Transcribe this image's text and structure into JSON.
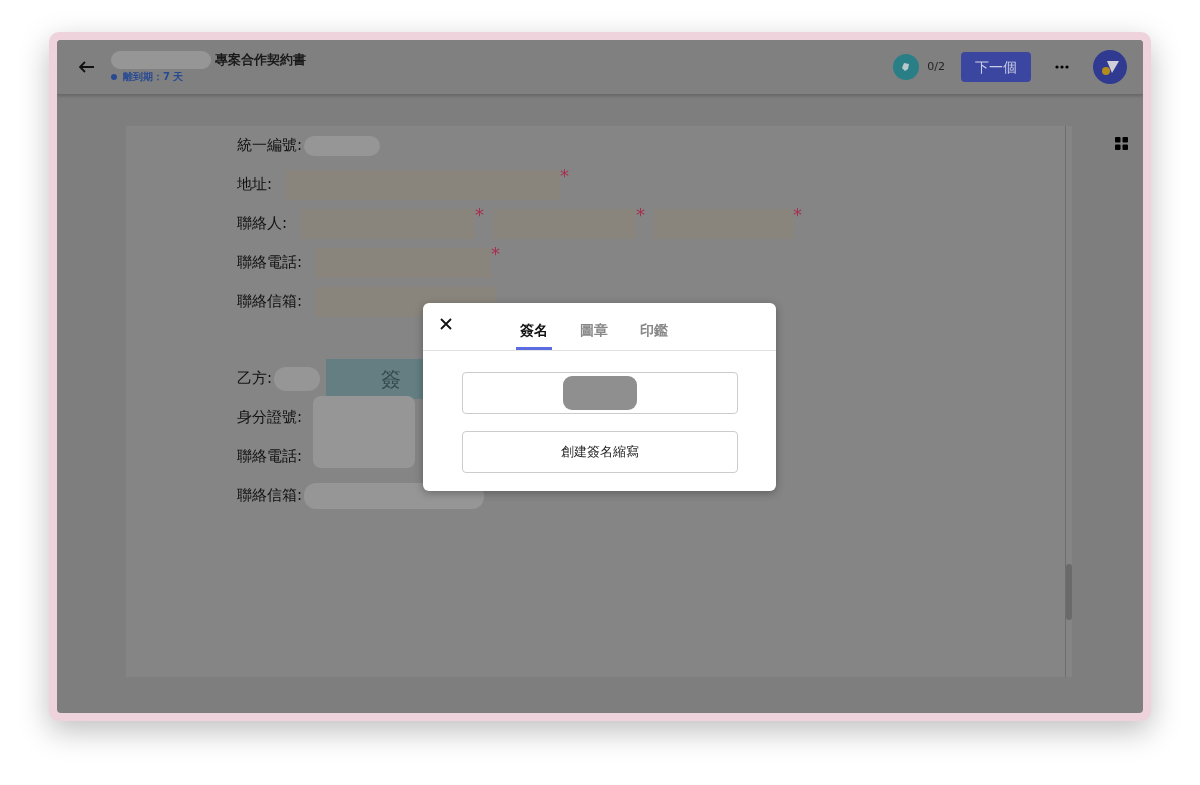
{
  "header": {
    "title": "專案合作契約書",
    "due": "離到期：7 天",
    "progress": "0/2",
    "next_button": "下一個"
  },
  "form": {
    "rows": [
      {
        "label": "統一編號:",
        "kind": "redacted"
      },
      {
        "label": "地址:",
        "kind": "fields",
        "fields": [
          {
            "required_mark": "*"
          }
        ]
      },
      {
        "label": "聯絡人:",
        "kind": "fields",
        "fields": [
          {
            "required_mark": "*"
          },
          {
            "required_mark": "*"
          },
          {
            "required_mark": "*"
          }
        ]
      },
      {
        "label": "聯絡電話:",
        "kind": "fields",
        "fields": [
          {
            "required_mark": "*"
          }
        ]
      },
      {
        "label": "聯絡信箱:",
        "kind": "field"
      },
      {
        "label": "乙方:",
        "kind": "sign",
        "button": "簽"
      },
      {
        "label": "身分證號:",
        "kind": "blank"
      },
      {
        "label": "聯絡電話:",
        "kind": "blank"
      },
      {
        "label": "聯絡信箱:",
        "kind": "redacted-wide"
      }
    ]
  },
  "dialog": {
    "tabs": [
      {
        "label": "簽名",
        "selected": true
      },
      {
        "label": "圖章",
        "selected": false
      },
      {
        "label": "印鑑",
        "selected": false
      }
    ],
    "create_button": "創建簽名縮寫"
  }
}
